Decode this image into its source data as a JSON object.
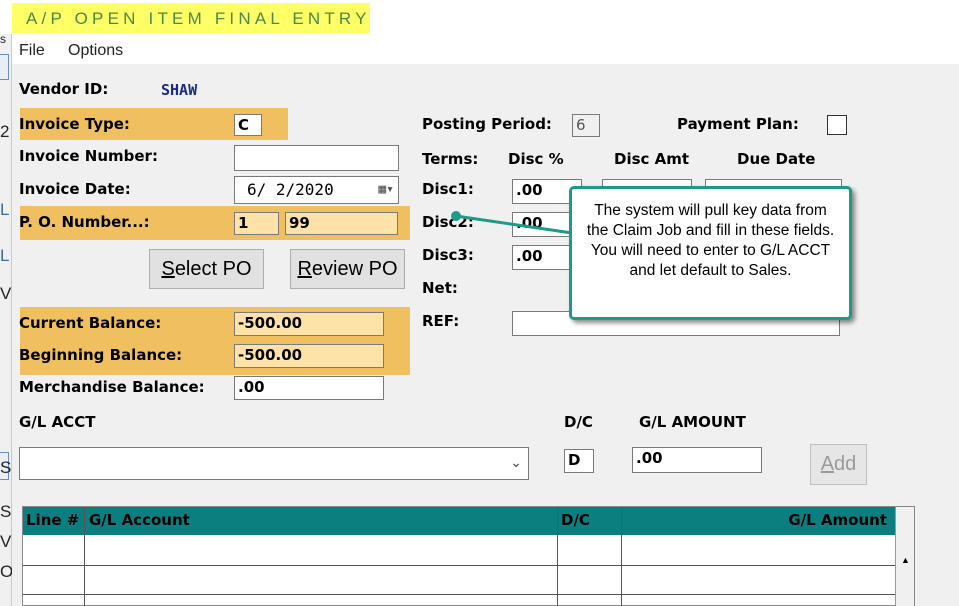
{
  "title": "A/P OPEN ITEM FINAL ENTRY",
  "menu": [
    "File",
    "Options"
  ],
  "left_fragments": [
    "s",
    "2",
    "L",
    "L",
    "V",
    "S",
    "S",
    "V",
    "O"
  ],
  "vendor": {
    "label": "Vendor ID:",
    "value": "SHAW"
  },
  "invoice_type": {
    "label": "Invoice Type:",
    "value": "C"
  },
  "invoice_number": {
    "label": "Invoice Number:",
    "value": ""
  },
  "invoice_date": {
    "label": "Invoice Date:",
    "value": "6/ 2/2020"
  },
  "po_number": {
    "label": "P. O. Number...:",
    "value1": "1",
    "value2": "99"
  },
  "buttons": {
    "select_po": "Select PO",
    "review_po": "Review PO",
    "add": "Add"
  },
  "posting_period": {
    "label": "Posting Period:",
    "value": "6"
  },
  "payment_plan": {
    "label": "Payment Plan:",
    "checked": false
  },
  "terms": {
    "label": "Terms:",
    "headers": [
      "Disc %",
      "Disc Amt",
      "Due Date"
    ],
    "rows": [
      {
        "label": "Disc1:",
        "disc_pct": ".00"
      },
      {
        "label": "Disc2:",
        "disc_pct": ".00"
      },
      {
        "label": "Disc3:",
        "disc_pct": ".00"
      }
    ],
    "net_label": "Net:",
    "ref_label": "REF:"
  },
  "balances": {
    "current": {
      "label": "Current Balance:",
      "value": "-500.00"
    },
    "beginning": {
      "label": "Beginning Balance:",
      "value": "-500.00"
    },
    "merchandise": {
      "label": "Merchandise Balance:",
      "value": ".00"
    }
  },
  "gl_entry": {
    "acct_label": "G/L ACCT",
    "acct_value": "",
    "dc_label": "D/C",
    "dc_value": "D",
    "amount_label": "G/L AMOUNT",
    "amount_value": ".00"
  },
  "grid": {
    "headers": [
      "Line #",
      "G/L Account",
      "D/C",
      "G/L Amount"
    ]
  },
  "callout_text": "The system will pull key data from the Claim Job and fill in these fields. You will need to enter to G/L ACCT and let default to Sales.",
  "colors": {
    "title_bg": "#ffff66",
    "highlight": "#f0c060",
    "grid_header": "#0b7f80",
    "callout_border": "#1e9b86",
    "vendor_text": "#1a2a8a"
  },
  "icons": [
    "calendar-dropdown-icon",
    "chevron-down-icon",
    "scroll-up-icon"
  ]
}
